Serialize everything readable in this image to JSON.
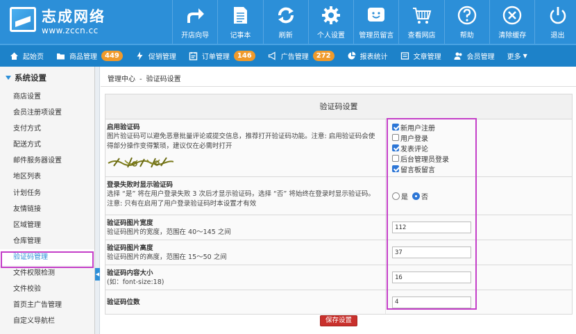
{
  "logo": {
    "title": "志成网络",
    "url": "www.zccn.cc"
  },
  "topnav": [
    {
      "label": "开店向导",
      "icon": "share-arrow-icon"
    },
    {
      "label": "记事本",
      "icon": "notepad-icon"
    },
    {
      "label": "刷新",
      "icon": "refresh-icon"
    },
    {
      "label": "个人设置",
      "icon": "gear-icon"
    },
    {
      "label": "管理员留言",
      "icon": "smiley-chat-icon"
    },
    {
      "label": "查看网店",
      "icon": "cart-icon"
    },
    {
      "label": "帮助",
      "icon": "help-icon"
    },
    {
      "label": "清除缓存",
      "icon": "close-circle-icon"
    },
    {
      "label": "退出",
      "icon": "power-icon"
    }
  ],
  "subnav": [
    {
      "label": "起始页",
      "icon": "home-icon"
    },
    {
      "label": "商品管理",
      "icon": "folder-icon",
      "badge": "449"
    },
    {
      "label": "促销管理",
      "icon": "lightning-icon"
    },
    {
      "label": "订单管理",
      "icon": "order-icon",
      "badge": "146"
    },
    {
      "label": "广告管理",
      "icon": "megaphone-icon",
      "badge": "272"
    },
    {
      "label": "报表统计",
      "icon": "pie-chart-icon"
    },
    {
      "label": "文章管理",
      "icon": "article-icon"
    },
    {
      "label": "会员管理",
      "icon": "members-icon"
    },
    {
      "label": "更多",
      "icon": ""
    }
  ],
  "sidebar": {
    "heading": "系统设置",
    "items": [
      "商店设置",
      "会员注册项设置",
      "支付方式",
      "配送方式",
      "邮件服务器设置",
      "地区列表",
      "计划任务",
      "友情链接",
      "区域管理",
      "仓库管理",
      "验证码管理",
      "文件权限检测",
      "文件校验",
      "首页主广告管理",
      "自定义导航栏"
    ],
    "active_index": 10
  },
  "breadcrumb": {
    "root": "管理中心",
    "sep": "-",
    "current": "验证码设置"
  },
  "form": {
    "title": "验证码设置",
    "rows": {
      "enable": {
        "label": "启用验证码",
        "desc": "图片验证码可以避免恶意批量评论或提交信息，推荐打开验证码功能。注意: 启用验证码会使得部分操作变得繁琐，建议仅在必需时打开",
        "options": [
          {
            "label": "新用户注册",
            "checked": true
          },
          {
            "label": "用户登录",
            "checked": false
          },
          {
            "label": "发表评论",
            "checked": true
          },
          {
            "label": "后台管理员登录",
            "checked": false
          },
          {
            "label": "留言板留言",
            "checked": true
          }
        ]
      },
      "fail": {
        "label": "登录失败时显示验证码",
        "desc": "选择 “是” 将在用户登录失败 3 次后才显示验证码，选择 “否” 将始终在登录时显示验证码。注意: 只有在启用了用户登录验证码时本设置才有效",
        "yes": "是",
        "no": "否",
        "selected": "no"
      },
      "width": {
        "label": "验证码图片宽度",
        "desc": "验证码图片的宽度，范围在 40～145 之间",
        "value": "112"
      },
      "height": {
        "label": "验证码图片高度",
        "desc": "验证码图片的高度，范围在 15～50 之间",
        "value": "37"
      },
      "fontsize": {
        "label": "验证码内容大小",
        "desc": "(如：font-size:18)",
        "value": "16"
      },
      "digits": {
        "label": "验证码位数",
        "value": "4"
      }
    },
    "save_label": "保存设置"
  },
  "colors": {
    "header": "#2c8fd8",
    "subnav": "#1d82c9",
    "badge": "#f09a2b",
    "highlight": "#c43ec8",
    "save": "#c9302c"
  }
}
